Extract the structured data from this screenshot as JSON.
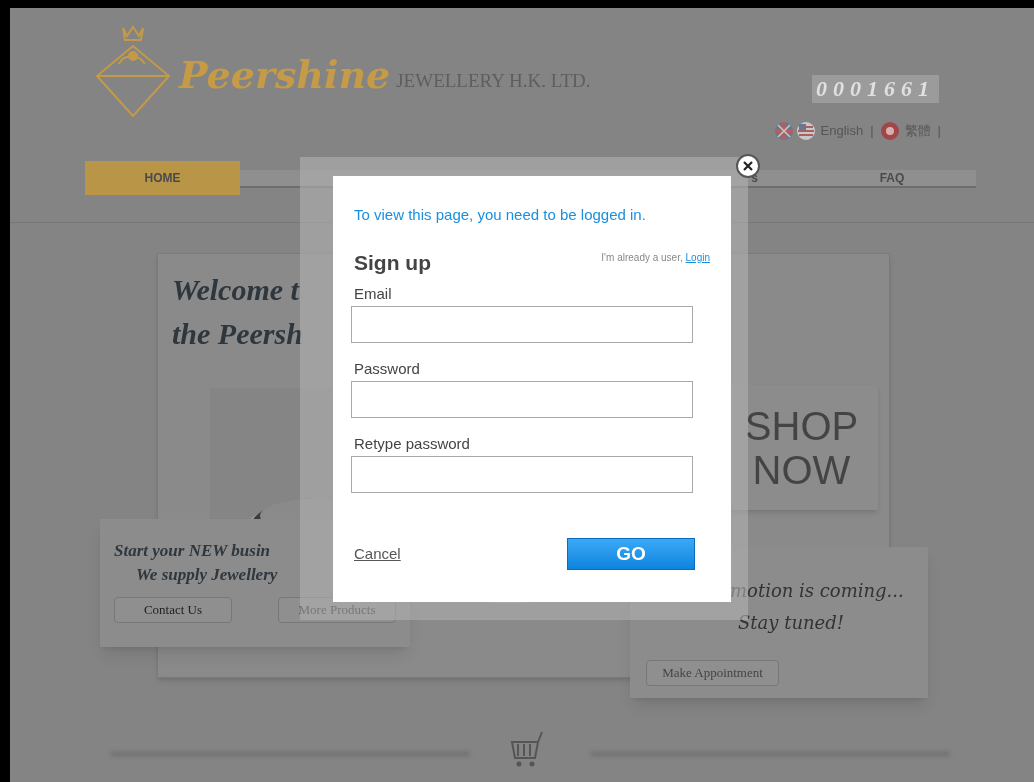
{
  "header": {
    "logo_script": "Peershine",
    "company": "JEWELLERY H.K. LTD.",
    "visitor_counter": "0001661",
    "languages": [
      {
        "label": "English",
        "separator": "|"
      },
      {
        "label": "繁體",
        "separator": "|"
      }
    ]
  },
  "nav": [
    {
      "label": "HOME",
      "selected": true
    },
    {
      "label": "s",
      "selected": false
    },
    {
      "label": "FAQ",
      "selected": false
    }
  ],
  "welcome": {
    "lines": [
      "Welcome t",
      "the Peersh"
    ]
  },
  "business_card": {
    "lines": [
      "Start your NEW busin",
      "We supply Jewellery"
    ],
    "buttons": [
      "Contact Us",
      "More Products"
    ]
  },
  "shop_now": {
    "lines": [
      "SHOP",
      "NOW"
    ]
  },
  "promotion_card": {
    "lines": [
      "motion is coming...",
      "Stay tuned!"
    ],
    "button": "Make Appointment"
  },
  "dialog": {
    "message": "To view this page, you need to be logged in.",
    "title": "Sign up",
    "already_user": "I'm already a user,",
    "login_link": "Login",
    "fields": [
      {
        "label": "Email"
      },
      {
        "label": "Password"
      },
      {
        "label": "Retype password"
      }
    ],
    "cancel": "Cancel",
    "submit": "GO"
  }
}
